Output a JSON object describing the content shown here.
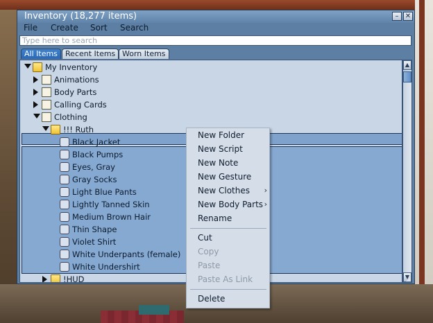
{
  "window": {
    "title": "Inventory (18,277 items)",
    "minimize_glyph": "–",
    "close_glyph": "✕"
  },
  "menubar": [
    "File",
    "Create",
    "Sort",
    "Search"
  ],
  "search": {
    "placeholder": "Type here to search",
    "value": ""
  },
  "tabs": [
    {
      "label": "All Items",
      "active": true
    },
    {
      "label": "Recent Items",
      "active": false
    },
    {
      "label": "Worn Items",
      "active": false
    }
  ],
  "tree": [
    {
      "label": "My Inventory",
      "icon": "folder-open-icon",
      "expanded": true
    },
    {
      "label": "Animations",
      "icon": "animation-icon",
      "expanded": false
    },
    {
      "label": "Body Parts",
      "icon": "body-parts-icon",
      "expanded": false
    },
    {
      "label": "Calling Cards",
      "icon": "calling-card-icon",
      "expanded": false
    },
    {
      "label": "Clothing",
      "icon": "clothing-folder-icon",
      "expanded": true
    },
    {
      "label": "!!! Ruth",
      "icon": "folder-open-icon",
      "expanded": true,
      "selected": true
    },
    {
      "label": "Black Jacket",
      "icon": "jacket-icon"
    },
    {
      "label": "Black Pumps",
      "icon": "shoes-icon"
    },
    {
      "label": "Eyes, Gray",
      "icon": "eyes-icon"
    },
    {
      "label": "Gray Socks",
      "icon": "socks-icon"
    },
    {
      "label": "Light Blue Pants",
      "icon": "pants-icon"
    },
    {
      "label": "Lightly Tanned Skin",
      "icon": "skin-icon"
    },
    {
      "label": "Medium Brown Hair",
      "icon": "hair-icon"
    },
    {
      "label": "Thin Shape",
      "icon": "shape-icon"
    },
    {
      "label": "Violet Shirt",
      "icon": "shirt-icon"
    },
    {
      "label": "White Underpants (female)",
      "icon": "underpants-icon"
    },
    {
      "label": "White Undershirt",
      "icon": "undershirt-icon"
    },
    {
      "label": "!HUD",
      "icon": "folder-icon",
      "expanded": false
    }
  ],
  "context_menu": {
    "items": [
      {
        "label": "New Folder",
        "enabled": true
      },
      {
        "label": "New Script",
        "enabled": true
      },
      {
        "label": "New Note",
        "enabled": true
      },
      {
        "label": "New Gesture",
        "enabled": true
      },
      {
        "label": "New Clothes",
        "enabled": true,
        "submenu": true
      },
      {
        "label": "New Body Parts",
        "enabled": true,
        "submenu": true
      },
      {
        "label": "Rename",
        "enabled": true
      },
      {
        "label": "Cut",
        "enabled": true
      },
      {
        "label": "Copy",
        "enabled": false
      },
      {
        "label": "Paste",
        "enabled": false
      },
      {
        "label": "Paste As Link",
        "enabled": false
      },
      {
        "label": "Delete",
        "enabled": true
      }
    ],
    "submenu_glyph": "›"
  },
  "colors": {
    "window_bg": "#5c7fa3",
    "tab_active": "#2a68b5",
    "selection": "#86a9d2",
    "menu_bg": "#d5dde8"
  }
}
